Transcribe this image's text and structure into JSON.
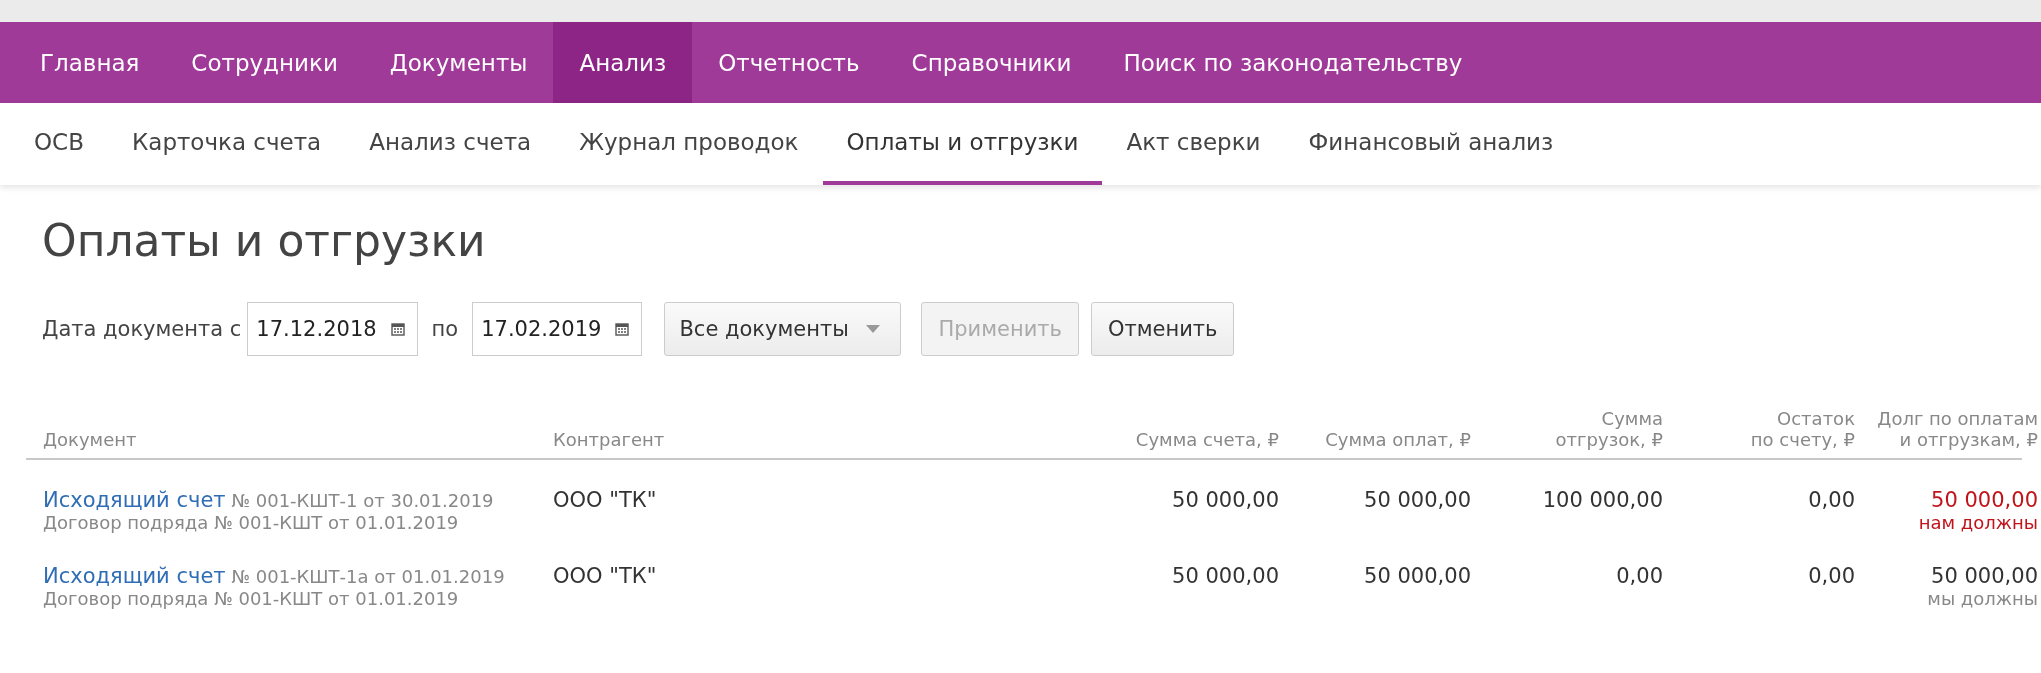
{
  "main_nav": [
    {
      "label": "Главная",
      "selected": false
    },
    {
      "label": "Сотрудники",
      "selected": false
    },
    {
      "label": "Документы",
      "selected": false
    },
    {
      "label": "Анализ",
      "selected": true
    },
    {
      "label": "Отчетность",
      "selected": false
    },
    {
      "label": "Справочники",
      "selected": false
    },
    {
      "label": "Поиск по законодательству",
      "selected": false
    }
  ],
  "sub_nav": [
    {
      "label": "ОСВ",
      "selected": false
    },
    {
      "label": "Карточка счета",
      "selected": false
    },
    {
      "label": "Анализ счета",
      "selected": false
    },
    {
      "label": "Журнал проводок",
      "selected": false
    },
    {
      "label": "Оплаты и отгрузки",
      "selected": true
    },
    {
      "label": "Акт сверки",
      "selected": false
    },
    {
      "label": "Финансовый анализ",
      "selected": false
    }
  ],
  "page_title": "Оплаты и отгрузки",
  "filters": {
    "date_label": "Дата документа с",
    "date_from": "17.12.2018",
    "to_label": "по",
    "date_to": "17.02.2019",
    "doc_type": "Все документы",
    "buttons": [
      {
        "label": "Применить",
        "disabled": true
      },
      {
        "label": "Отменить",
        "disabled": false
      }
    ]
  },
  "table": {
    "columns": [
      {
        "lines": [
          "Документ"
        ]
      },
      {
        "lines": [
          "Контрагент"
        ]
      },
      {
        "lines": [
          "Сумма счета, ₽"
        ]
      },
      {
        "lines": [
          "Сумма оплат, ₽"
        ]
      },
      {
        "lines": [
          "Сумма",
          "отгрузок, ₽"
        ]
      },
      {
        "lines": [
          "Остаток",
          "по счету, ₽"
        ]
      },
      {
        "lines": [
          "Долг по оплатам",
          "и отгрузкам, ₽"
        ]
      }
    ],
    "rows": [
      {
        "doc_link": "Исходящий счет",
        "doc_number": "№ 001-КШТ-1 от 30.01.2019",
        "contract": "Договор подряда № 001-КШТ от 01.01.2019",
        "counterparty": "ООО \"ТК\"",
        "invoice_sum": "50 000,00",
        "payments_sum": "50 000,00",
        "shipments_sum": "100 000,00",
        "remainder": "0,00",
        "debt": "50 000,00",
        "debt_note": "нам должны",
        "owed_to_us": true
      },
      {
        "doc_link": "Исходящий счет",
        "doc_number": "№ 001-КШТ-1а от 01.01.2019",
        "contract": "Договор подряда № 001-КШТ от 01.01.2019",
        "counterparty": "ООО \"ТК\"",
        "invoice_sum": "50 000,00",
        "payments_sum": "50 000,00",
        "shipments_sum": "0,00",
        "remainder": "0,00",
        "debt": "50 000,00",
        "debt_note": "мы должны",
        "owed_to_us": false
      }
    ]
  }
}
